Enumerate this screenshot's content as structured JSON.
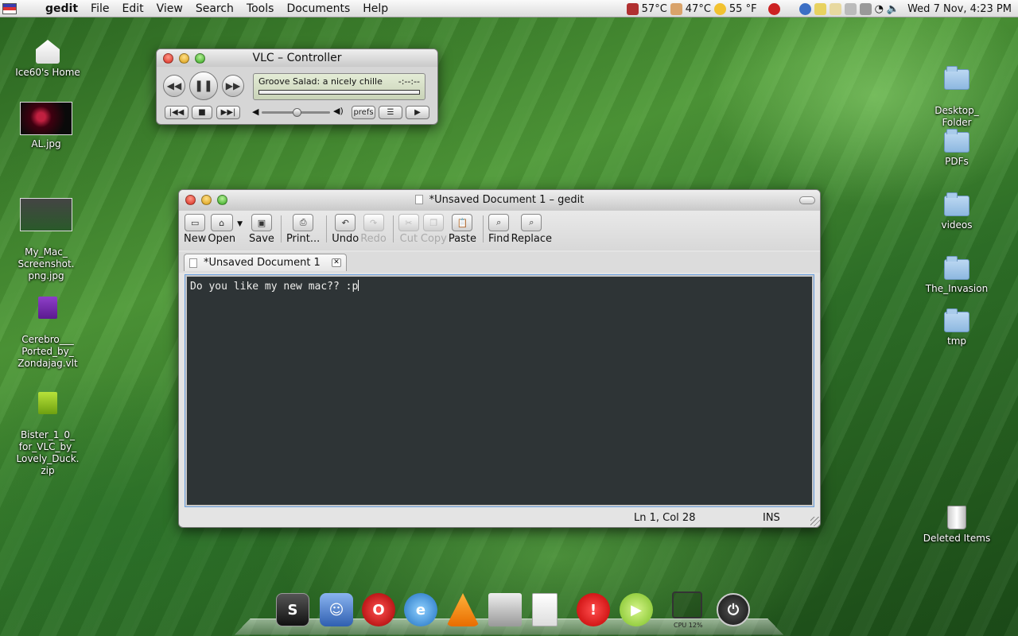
{
  "menubar": {
    "app_name": "gedit",
    "menus": [
      "File",
      "Edit",
      "View",
      "Search",
      "Tools",
      "Documents",
      "Help"
    ],
    "temps": {
      "cpu": "57°C",
      "hdd": "47°C",
      "weather": "55 °F"
    },
    "clock": "Wed  7 Nov,  4:23 PM",
    "colors": {
      "cpu_icon": "#b03030",
      "weather_icon": "#f2c230"
    }
  },
  "desktop": {
    "left_icons": [
      {
        "label": "Ice60's Home",
        "icon": "home-icon"
      },
      {
        "label": "AL.jpg",
        "icon": "image-icon"
      },
      {
        "label": "My_Mac_\nScreenshot.\npng.jpg",
        "icon": "image-icon"
      },
      {
        "label": "Cerebro___\nPorted_by_\nZondajag.vlt",
        "icon": "archive-icon"
      },
      {
        "label": "Bister_1_0_\nfor_VLC_by_\nLovely_Duck.\nzip",
        "icon": "zip-icon"
      }
    ],
    "right_icons": [
      {
        "label": "Desktop_\nFolder",
        "icon": "folder-icon"
      },
      {
        "label": "PDFs",
        "icon": "folder-icon"
      },
      {
        "label": "videos",
        "icon": "folder-icon"
      },
      {
        "label": "The_Invasion",
        "icon": "folder-icon"
      },
      {
        "label": "tmp",
        "icon": "folder-icon"
      },
      {
        "label": "Deleted Items",
        "icon": "trash-icon"
      }
    ]
  },
  "vlc": {
    "title": "VLC – Controller",
    "now_playing": "Groove Salad: a nicely chille",
    "time": "-:--:--",
    "prefs_label": "prefs",
    "volume_level": 0.55
  },
  "gedit": {
    "title": "*Unsaved Document 1 – gedit",
    "toolbar": {
      "new": "New",
      "open": "Open",
      "save": "Save",
      "print": "Print...",
      "undo": "Undo",
      "redo": "Redo",
      "cut": "Cut",
      "copy": "Copy",
      "paste": "Paste",
      "find": "Find",
      "replace": "Replace"
    },
    "tab_label": "*Unsaved Document 1",
    "content": "Do you like my new mac?? :p",
    "status": {
      "position": "Ln 1, Col 28",
      "mode": "INS"
    },
    "colors": {
      "editor_bg": "#2e3436",
      "editor_fg": "#eeeeec"
    }
  },
  "dock": {
    "items": [
      "terminal-icon",
      "finder-icon",
      "opera-icon",
      "browser-icon",
      "vlc-icon",
      "calendar-icon",
      "text-editor-icon",
      "alert-icon",
      "play-icon",
      "cpu-monitor-icon",
      "power-icon"
    ],
    "cpu_label": "CPU 12%"
  }
}
